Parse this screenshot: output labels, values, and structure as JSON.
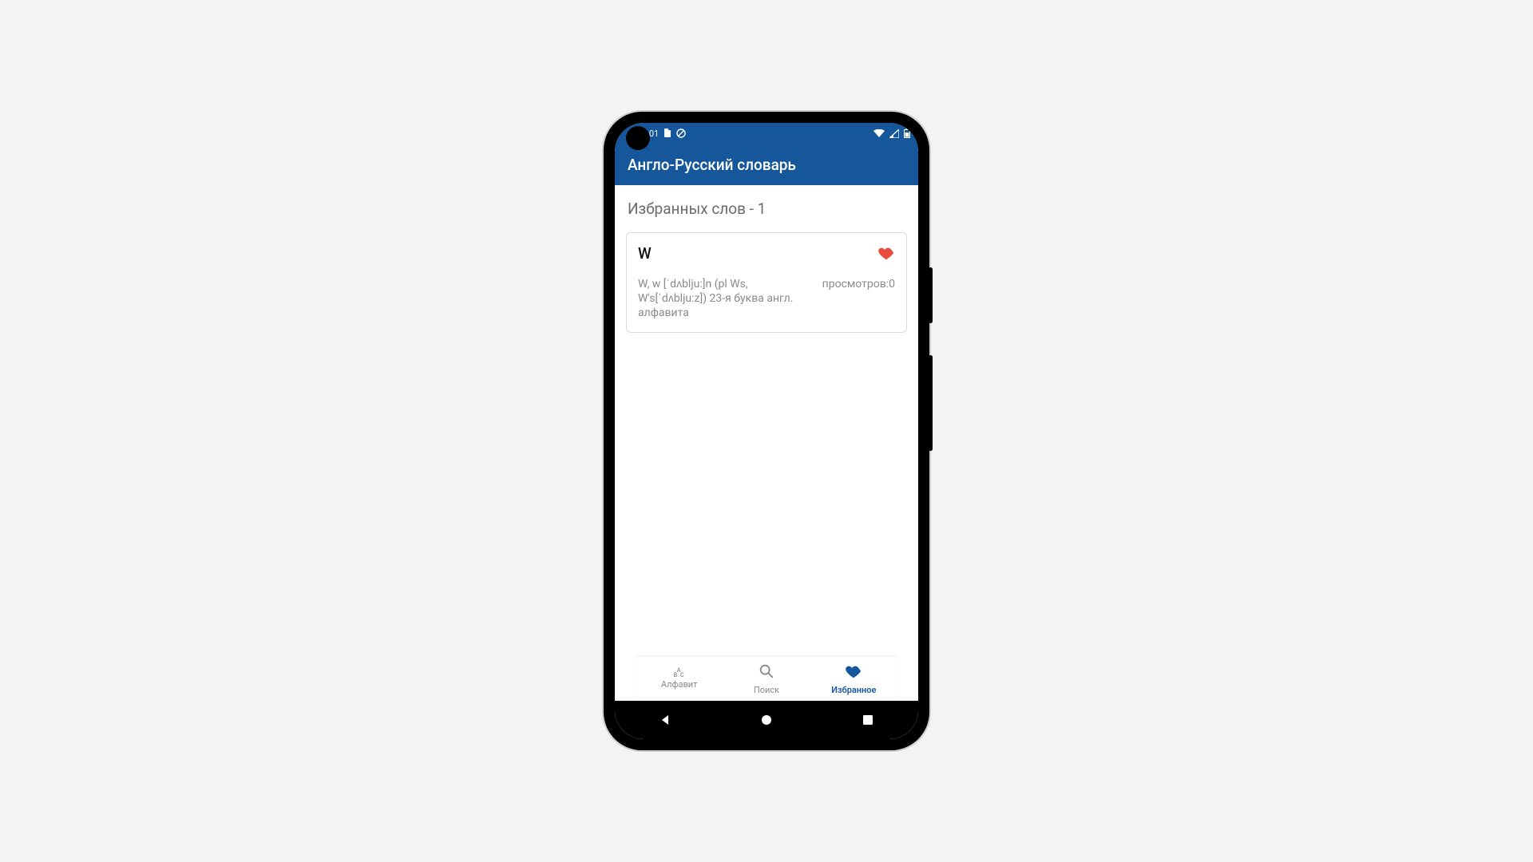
{
  "statusbar": {
    "time": "1:01"
  },
  "appbar": {
    "title": "Англо-Русский словарь"
  },
  "content": {
    "count_label": "Избранных слов - 1",
    "card": {
      "word": "W",
      "definition": "W, w [ˈdʌblju:]n (pl Ws, W's[ˈdʌblju:z]) 23-я буква англ. алфавита",
      "views_label": "просмотров:0"
    }
  },
  "bottomnav": {
    "items": [
      {
        "label": "Алфавит",
        "active": false,
        "name": "alphabet"
      },
      {
        "label": "Поиск",
        "active": false,
        "name": "search"
      },
      {
        "label": "Избранное",
        "active": true,
        "name": "favorites"
      }
    ]
  }
}
